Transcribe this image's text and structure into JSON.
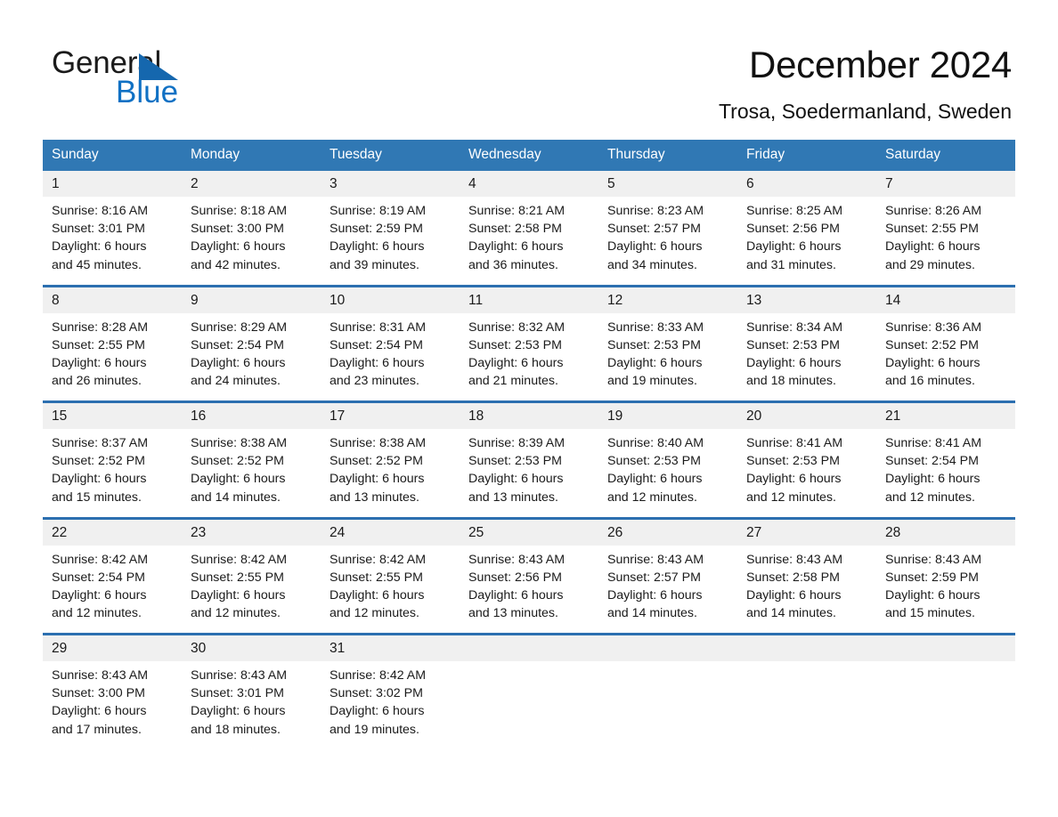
{
  "brand": {
    "name_part1": "General",
    "name_part2": "Blue",
    "accent_color": "#1071c4",
    "triangle_color": "#1567ae"
  },
  "header": {
    "title": "December 2024",
    "subtitle": "Trosa, Soedermanland, Sweden"
  },
  "calendar": {
    "header_bg": "#3078b4",
    "daynum_bg": "#f0f0f0",
    "separator_color": "#2c6fb0",
    "weekday_headers": [
      "Sunday",
      "Monday",
      "Tuesday",
      "Wednesday",
      "Thursday",
      "Friday",
      "Saturday"
    ],
    "weeks": [
      [
        {
          "day": "1",
          "sunrise": "Sunrise: 8:16 AM",
          "sunset": "Sunset: 3:01 PM",
          "daylight_line1": "Daylight: 6 hours",
          "daylight_line2": "and 45 minutes."
        },
        {
          "day": "2",
          "sunrise": "Sunrise: 8:18 AM",
          "sunset": "Sunset: 3:00 PM",
          "daylight_line1": "Daylight: 6 hours",
          "daylight_line2": "and 42 minutes."
        },
        {
          "day": "3",
          "sunrise": "Sunrise: 8:19 AM",
          "sunset": "Sunset: 2:59 PM",
          "daylight_line1": "Daylight: 6 hours",
          "daylight_line2": "and 39 minutes."
        },
        {
          "day": "4",
          "sunrise": "Sunrise: 8:21 AM",
          "sunset": "Sunset: 2:58 PM",
          "daylight_line1": "Daylight: 6 hours",
          "daylight_line2": "and 36 minutes."
        },
        {
          "day": "5",
          "sunrise": "Sunrise: 8:23 AM",
          "sunset": "Sunset: 2:57 PM",
          "daylight_line1": "Daylight: 6 hours",
          "daylight_line2": "and 34 minutes."
        },
        {
          "day": "6",
          "sunrise": "Sunrise: 8:25 AM",
          "sunset": "Sunset: 2:56 PM",
          "daylight_line1": "Daylight: 6 hours",
          "daylight_line2": "and 31 minutes."
        },
        {
          "day": "7",
          "sunrise": "Sunrise: 8:26 AM",
          "sunset": "Sunset: 2:55 PM",
          "daylight_line1": "Daylight: 6 hours",
          "daylight_line2": "and 29 minutes."
        }
      ],
      [
        {
          "day": "8",
          "sunrise": "Sunrise: 8:28 AM",
          "sunset": "Sunset: 2:55 PM",
          "daylight_line1": "Daylight: 6 hours",
          "daylight_line2": "and 26 minutes."
        },
        {
          "day": "9",
          "sunrise": "Sunrise: 8:29 AM",
          "sunset": "Sunset: 2:54 PM",
          "daylight_line1": "Daylight: 6 hours",
          "daylight_line2": "and 24 minutes."
        },
        {
          "day": "10",
          "sunrise": "Sunrise: 8:31 AM",
          "sunset": "Sunset: 2:54 PM",
          "daylight_line1": "Daylight: 6 hours",
          "daylight_line2": "and 23 minutes."
        },
        {
          "day": "11",
          "sunrise": "Sunrise: 8:32 AM",
          "sunset": "Sunset: 2:53 PM",
          "daylight_line1": "Daylight: 6 hours",
          "daylight_line2": "and 21 minutes."
        },
        {
          "day": "12",
          "sunrise": "Sunrise: 8:33 AM",
          "sunset": "Sunset: 2:53 PM",
          "daylight_line1": "Daylight: 6 hours",
          "daylight_line2": "and 19 minutes."
        },
        {
          "day": "13",
          "sunrise": "Sunrise: 8:34 AM",
          "sunset": "Sunset: 2:53 PM",
          "daylight_line1": "Daylight: 6 hours",
          "daylight_line2": "and 18 minutes."
        },
        {
          "day": "14",
          "sunrise": "Sunrise: 8:36 AM",
          "sunset": "Sunset: 2:52 PM",
          "daylight_line1": "Daylight: 6 hours",
          "daylight_line2": "and 16 minutes."
        }
      ],
      [
        {
          "day": "15",
          "sunrise": "Sunrise: 8:37 AM",
          "sunset": "Sunset: 2:52 PM",
          "daylight_line1": "Daylight: 6 hours",
          "daylight_line2": "and 15 minutes."
        },
        {
          "day": "16",
          "sunrise": "Sunrise: 8:38 AM",
          "sunset": "Sunset: 2:52 PM",
          "daylight_line1": "Daylight: 6 hours",
          "daylight_line2": "and 14 minutes."
        },
        {
          "day": "17",
          "sunrise": "Sunrise: 8:38 AM",
          "sunset": "Sunset: 2:52 PM",
          "daylight_line1": "Daylight: 6 hours",
          "daylight_line2": "and 13 minutes."
        },
        {
          "day": "18",
          "sunrise": "Sunrise: 8:39 AM",
          "sunset": "Sunset: 2:53 PM",
          "daylight_line1": "Daylight: 6 hours",
          "daylight_line2": "and 13 minutes."
        },
        {
          "day": "19",
          "sunrise": "Sunrise: 8:40 AM",
          "sunset": "Sunset: 2:53 PM",
          "daylight_line1": "Daylight: 6 hours",
          "daylight_line2": "and 12 minutes."
        },
        {
          "day": "20",
          "sunrise": "Sunrise: 8:41 AM",
          "sunset": "Sunset: 2:53 PM",
          "daylight_line1": "Daylight: 6 hours",
          "daylight_line2": "and 12 minutes."
        },
        {
          "day": "21",
          "sunrise": "Sunrise: 8:41 AM",
          "sunset": "Sunset: 2:54 PM",
          "daylight_line1": "Daylight: 6 hours",
          "daylight_line2": "and 12 minutes."
        }
      ],
      [
        {
          "day": "22",
          "sunrise": "Sunrise: 8:42 AM",
          "sunset": "Sunset: 2:54 PM",
          "daylight_line1": "Daylight: 6 hours",
          "daylight_line2": "and 12 minutes."
        },
        {
          "day": "23",
          "sunrise": "Sunrise: 8:42 AM",
          "sunset": "Sunset: 2:55 PM",
          "daylight_line1": "Daylight: 6 hours",
          "daylight_line2": "and 12 minutes."
        },
        {
          "day": "24",
          "sunrise": "Sunrise: 8:42 AM",
          "sunset": "Sunset: 2:55 PM",
          "daylight_line1": "Daylight: 6 hours",
          "daylight_line2": "and 12 minutes."
        },
        {
          "day": "25",
          "sunrise": "Sunrise: 8:43 AM",
          "sunset": "Sunset: 2:56 PM",
          "daylight_line1": "Daylight: 6 hours",
          "daylight_line2": "and 13 minutes."
        },
        {
          "day": "26",
          "sunrise": "Sunrise: 8:43 AM",
          "sunset": "Sunset: 2:57 PM",
          "daylight_line1": "Daylight: 6 hours",
          "daylight_line2": "and 14 minutes."
        },
        {
          "day": "27",
          "sunrise": "Sunrise: 8:43 AM",
          "sunset": "Sunset: 2:58 PM",
          "daylight_line1": "Daylight: 6 hours",
          "daylight_line2": "and 14 minutes."
        },
        {
          "day": "28",
          "sunrise": "Sunrise: 8:43 AM",
          "sunset": "Sunset: 2:59 PM",
          "daylight_line1": "Daylight: 6 hours",
          "daylight_line2": "and 15 minutes."
        }
      ],
      [
        {
          "day": "29",
          "sunrise": "Sunrise: 8:43 AM",
          "sunset": "Sunset: 3:00 PM",
          "daylight_line1": "Daylight: 6 hours",
          "daylight_line2": "and 17 minutes."
        },
        {
          "day": "30",
          "sunrise": "Sunrise: 8:43 AM",
          "sunset": "Sunset: 3:01 PM",
          "daylight_line1": "Daylight: 6 hours",
          "daylight_line2": "and 18 minutes."
        },
        {
          "day": "31",
          "sunrise": "Sunrise: 8:42 AM",
          "sunset": "Sunset: 3:02 PM",
          "daylight_line1": "Daylight: 6 hours",
          "daylight_line2": "and 19 minutes."
        },
        {
          "day": "",
          "sunrise": "",
          "sunset": "",
          "daylight_line1": "",
          "daylight_line2": ""
        },
        {
          "day": "",
          "sunrise": "",
          "sunset": "",
          "daylight_line1": "",
          "daylight_line2": ""
        },
        {
          "day": "",
          "sunrise": "",
          "sunset": "",
          "daylight_line1": "",
          "daylight_line2": ""
        },
        {
          "day": "",
          "sunrise": "",
          "sunset": "",
          "daylight_line1": "",
          "daylight_line2": ""
        }
      ]
    ]
  }
}
